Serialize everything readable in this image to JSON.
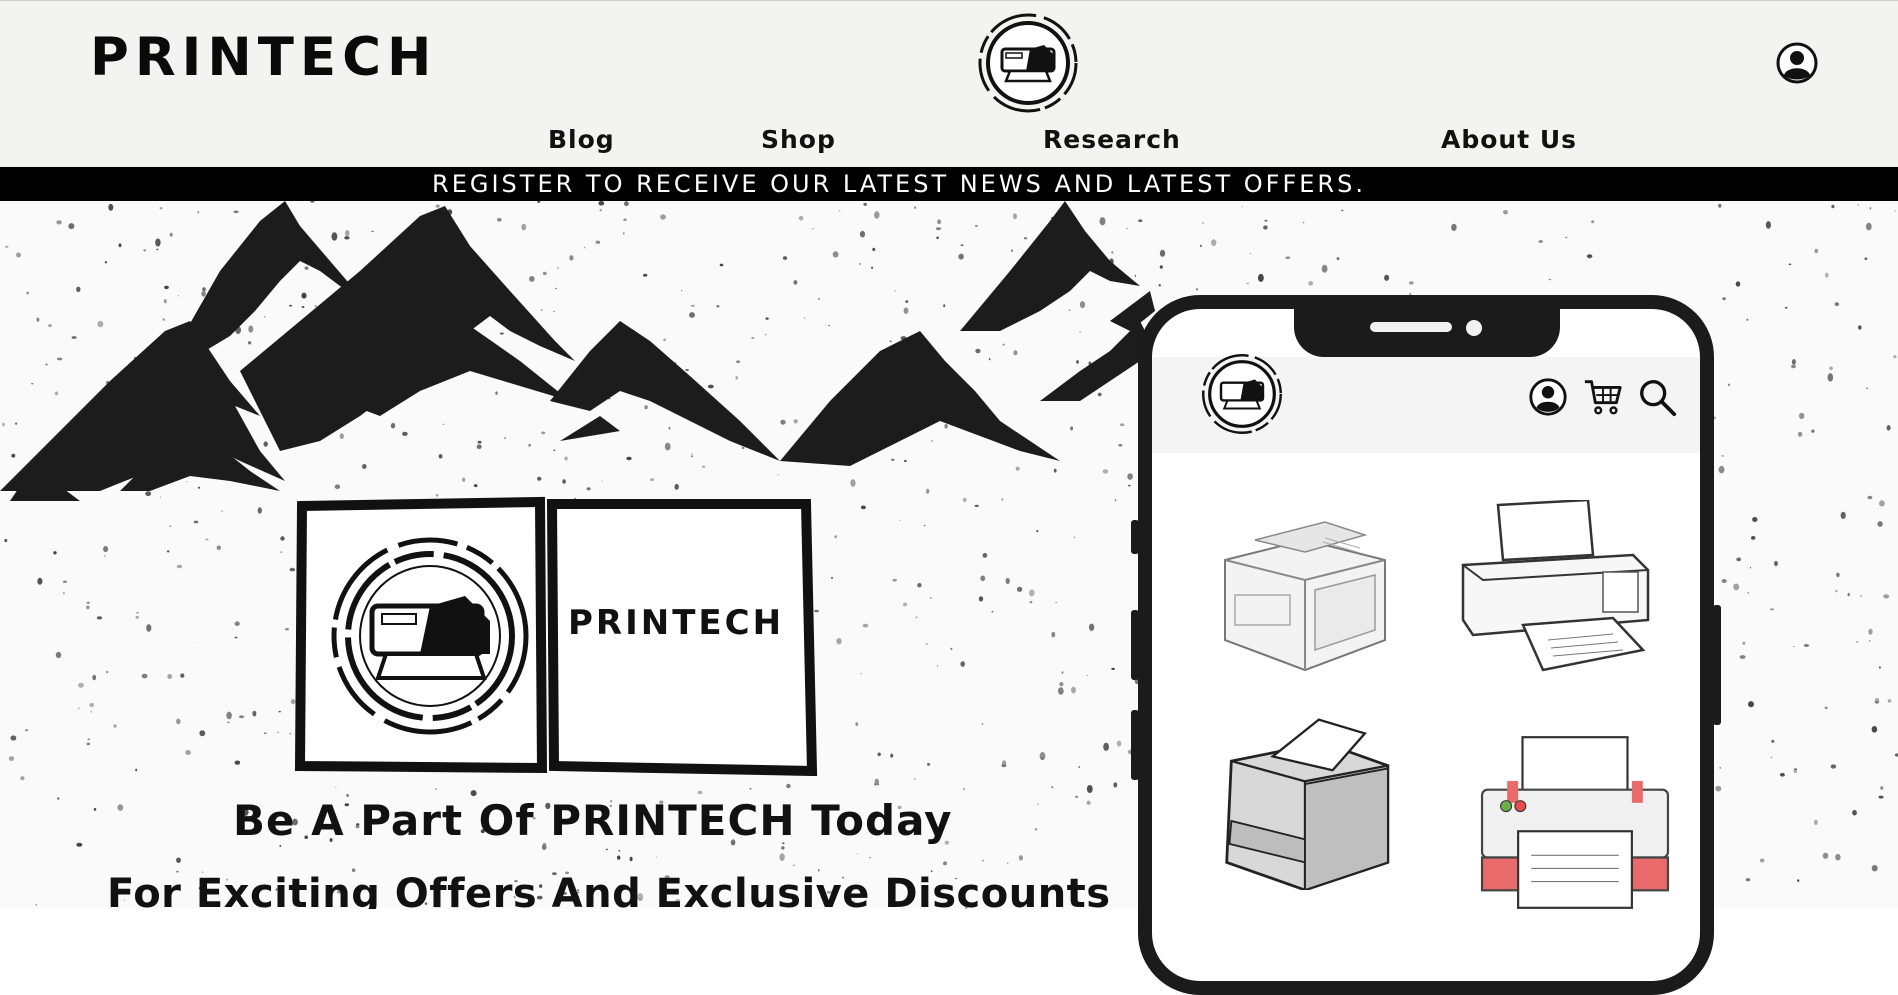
{
  "header": {
    "brand": "PRINTECH",
    "logo_icon": "printer-logo-icon",
    "account_icon": "user-account-icon"
  },
  "nav": {
    "items": [
      {
        "label": "Blog"
      },
      {
        "label": "Shop"
      },
      {
        "label": "Research"
      },
      {
        "label": "About Us"
      }
    ]
  },
  "promo": {
    "text": "REGISTER TO RECEIVE OUR LATEST NEWS AND LATEST OFFERS."
  },
  "hero": {
    "box_logo_text": "PRINTECH",
    "tagline_1": "Be A Part Of PRINTECH Today",
    "tagline_2": "For Exciting Offers And Exclusive Discounts"
  },
  "phone": {
    "icons": [
      "user-account-icon",
      "shopping-cart-icon",
      "search-icon"
    ],
    "products": [
      "laser-printer",
      "inkjet-printer",
      "office-printer",
      "color-printer"
    ]
  },
  "colors": {
    "header_bg": "#f3f3f2",
    "promo_bg": "#000000",
    "ink": "#111111",
    "accent_red": "#e86a6a"
  }
}
